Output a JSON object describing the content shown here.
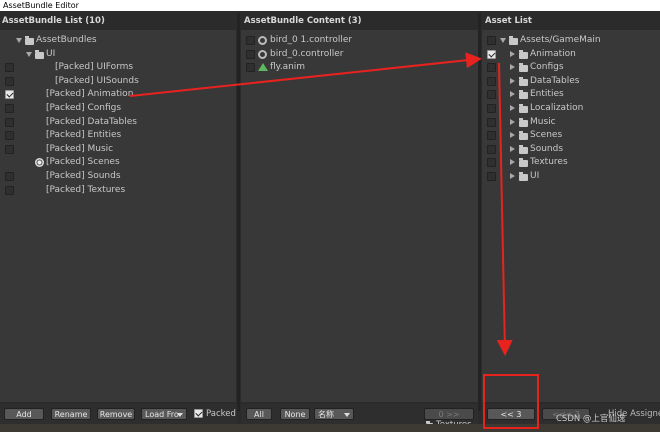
{
  "window": {
    "title": "AssetBundle Editor"
  },
  "left_panel": {
    "header": "AssetBundle List (10)",
    "rows": [
      {
        "label": "AssetBundles",
        "kind": "folder",
        "indent": 0,
        "checkbox": false,
        "checked": false,
        "icon": ""
      },
      {
        "label": "UI",
        "kind": "folder",
        "indent": 1,
        "checkbox": false,
        "checked": false,
        "icon": ""
      },
      {
        "label": "[Packed] UIForms",
        "kind": "bundle",
        "indent": 2,
        "checkbox": true,
        "checked": false,
        "icon": ""
      },
      {
        "label": "[Packed] UISounds",
        "kind": "bundle",
        "indent": 2,
        "checkbox": true,
        "checked": false,
        "icon": ""
      },
      {
        "label": "[Packed] Animation",
        "kind": "bundle",
        "indent": 1,
        "checkbox": true,
        "checked": true,
        "icon": ""
      },
      {
        "label": "[Packed] Configs",
        "kind": "bundle",
        "indent": 1,
        "checkbox": true,
        "checked": false,
        "icon": ""
      },
      {
        "label": "[Packed] DataTables",
        "kind": "bundle",
        "indent": 1,
        "checkbox": true,
        "checked": false,
        "icon": ""
      },
      {
        "label": "[Packed] Entities",
        "kind": "bundle",
        "indent": 1,
        "checkbox": true,
        "checked": false,
        "icon": ""
      },
      {
        "label": "[Packed] Music",
        "kind": "bundle",
        "indent": 1,
        "checkbox": true,
        "checked": false,
        "icon": ""
      },
      {
        "label": "[Packed] Scenes",
        "kind": "bundle",
        "indent": 1,
        "checkbox": false,
        "checked": false,
        "icon": "unity-scene-icon"
      },
      {
        "label": "[Packed] Sounds",
        "kind": "bundle",
        "indent": 1,
        "checkbox": true,
        "checked": false,
        "icon": ""
      },
      {
        "label": "[Packed] Textures",
        "kind": "bundle",
        "indent": 1,
        "checkbox": true,
        "checked": false,
        "icon": ""
      }
    ],
    "buttons": {
      "add": "Add",
      "rename": "Rename",
      "remove": "Remove",
      "load_from": "Load Fro",
      "packed": "Packed"
    }
  },
  "middle_panel": {
    "header": "AssetBundle Content (3)",
    "rows": [
      {
        "label": "bird_0 1.controller",
        "icon": "animator-controller-icon"
      },
      {
        "label": "bird_0.controller",
        "icon": "animator-controller-icon"
      },
      {
        "label": "fly.anim",
        "icon": "animation-clip-icon"
      }
    ],
    "buttons": {
      "all": "All",
      "none": "None",
      "sort": "名称",
      "move": "0 >>"
    },
    "status_folder": "Textures"
  },
  "right_panel": {
    "header": "Asset List",
    "rows": [
      {
        "label": "Assets/GameMain",
        "indent": 0,
        "expanded": true,
        "checked": false
      },
      {
        "label": "Animation",
        "indent": 1,
        "expanded": false,
        "checked": true
      },
      {
        "label": "Configs",
        "indent": 1,
        "expanded": false,
        "checked": false
      },
      {
        "label": "DataTables",
        "indent": 1,
        "expanded": false,
        "checked": false
      },
      {
        "label": "Entities",
        "indent": 1,
        "expanded": false,
        "checked": false
      },
      {
        "label": "Localization",
        "indent": 1,
        "expanded": false,
        "checked": false
      },
      {
        "label": "Music",
        "indent": 1,
        "expanded": false,
        "checked": false
      },
      {
        "label": "Scenes",
        "indent": 1,
        "expanded": false,
        "checked": false
      },
      {
        "label": "Sounds",
        "indent": 1,
        "expanded": false,
        "checked": false
      },
      {
        "label": "Textures",
        "indent": 1,
        "expanded": false,
        "checked": false
      },
      {
        "label": "UI",
        "indent": 1,
        "expanded": false,
        "checked": false
      }
    ],
    "buttons": {
      "move_back": "<< 3",
      "move_back_dim": "<<< 3",
      "hide": "Hide Assigne"
    }
  },
  "watermark": "CSDN @上官仙逸",
  "colors": {
    "annotation": "#e8231f",
    "panel": "#383838",
    "background": "#2b2b2b"
  }
}
